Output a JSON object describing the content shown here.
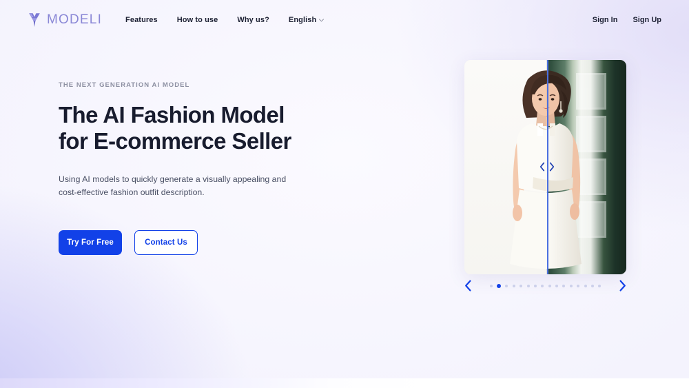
{
  "brand": {
    "name": "MODELI",
    "logo_icon": "butterfly-logo-icon",
    "color": "#8a87d6"
  },
  "nav": {
    "links": [
      {
        "label": "Features"
      },
      {
        "label": "How to use"
      },
      {
        "label": "Why us?"
      }
    ],
    "language": {
      "label": "English",
      "icon": "chevron-down-icon"
    },
    "auth": [
      {
        "label": "Sign In"
      },
      {
        "label": "Sign Up"
      }
    ]
  },
  "hero": {
    "eyebrow": "THE NEXT GENERATION AI MODEL",
    "headline": "The AI Fashion Model\nfor E-commerce Seller",
    "subcopy": "Using AI models to quickly generate a visually appealing and cost-effective fashion outfit description.",
    "primary_cta": "Try For Free",
    "secondary_cta": "Contact Us",
    "accent_color": "#1241e8",
    "headline_color": "#181c2e"
  },
  "compare_slider": {
    "divider_position_percent": 51,
    "handle_icon_left": "chevron-left-icon",
    "handle_icon_right": "chevron-right-icon",
    "left_label": "before-plain-white-background",
    "right_label": "after-green-door-background"
  },
  "carousel": {
    "prev_icon": "chevron-left-icon",
    "next_icon": "chevron-right-icon",
    "total_slides": 16,
    "active_index": 1,
    "active_dot_color": "#1241e8",
    "inactive_dot_color": "#ccd0ea"
  }
}
